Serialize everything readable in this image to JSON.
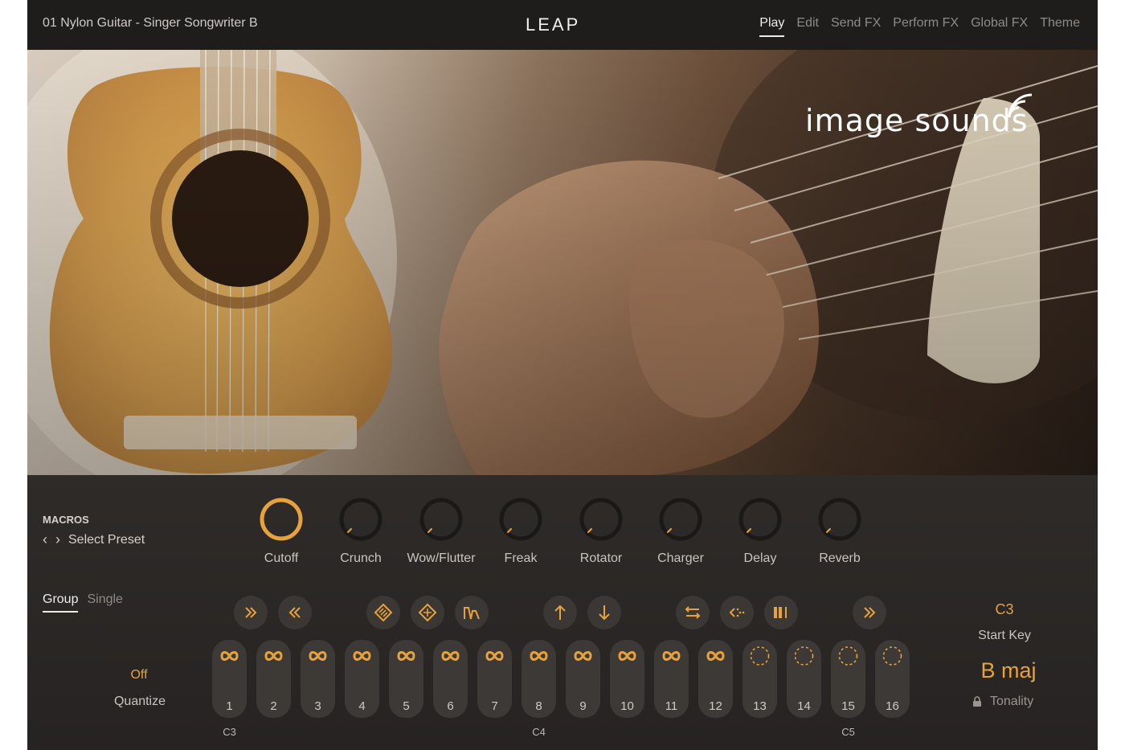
{
  "header": {
    "preset_name": "01 Nylon Guitar - Singer Songwriter B",
    "logo": "LEAP",
    "tabs": [
      {
        "label": "Play",
        "active": true
      },
      {
        "label": "Edit",
        "active": false
      },
      {
        "label": "Send FX",
        "active": false
      },
      {
        "label": "Perform FX",
        "active": false
      },
      {
        "label": "Global FX",
        "active": false
      },
      {
        "label": "Theme",
        "active": false
      }
    ]
  },
  "hero": {
    "brand_logo": "image sounds"
  },
  "macros": {
    "title": "MACROS",
    "select_preset_label": "Select Preset",
    "knobs": [
      {
        "label": "Cutoff",
        "active": true
      },
      {
        "label": "Crunch",
        "active": false
      },
      {
        "label": "Wow/Flutter",
        "active": false
      },
      {
        "label": "Freak",
        "active": false
      },
      {
        "label": "Rotator",
        "active": false
      },
      {
        "label": "Charger",
        "active": false
      },
      {
        "label": "Delay",
        "active": false
      },
      {
        "label": "Reverb",
        "active": false
      }
    ]
  },
  "mode": {
    "tabs": [
      {
        "label": "Group",
        "active": true
      },
      {
        "label": "Single",
        "active": false
      }
    ]
  },
  "quantize": {
    "value": "Off",
    "label": "Quantize"
  },
  "modifier_buttons": [
    {
      "icon": "fast-forward-icon"
    },
    {
      "icon": "rewind-icon"
    },
    {
      "icon": "stutter-a-icon"
    },
    {
      "icon": "stutter-b-icon"
    },
    {
      "icon": "envelope-icon"
    },
    {
      "icon": "pitch-up-icon"
    },
    {
      "icon": "pitch-down-icon"
    },
    {
      "icon": "reverse-icon"
    },
    {
      "icon": "scatter-icon"
    },
    {
      "icon": "slice-icon"
    },
    {
      "icon": "fast-forward-icon"
    }
  ],
  "pads": [
    {
      "number": "1",
      "mode": "loop"
    },
    {
      "number": "2",
      "mode": "loop"
    },
    {
      "number": "3",
      "mode": "loop"
    },
    {
      "number": "4",
      "mode": "loop"
    },
    {
      "number": "5",
      "mode": "loop"
    },
    {
      "number": "6",
      "mode": "loop"
    },
    {
      "number": "7",
      "mode": "loop"
    },
    {
      "number": "8",
      "mode": "loop"
    },
    {
      "number": "9",
      "mode": "loop"
    },
    {
      "number": "10",
      "mode": "loop"
    },
    {
      "number": "11",
      "mode": "loop"
    },
    {
      "number": "12",
      "mode": "loop"
    },
    {
      "number": "13",
      "mode": "one-shot"
    },
    {
      "number": "14",
      "mode": "one-shot"
    },
    {
      "number": "15",
      "mode": "one-shot"
    },
    {
      "number": "16",
      "mode": "one-shot"
    }
  ],
  "note_labels": [
    "C3",
    "C4",
    "C5"
  ],
  "keys": {
    "start_key_value": "C3",
    "start_key_label": "Start Key",
    "tonality_value": "B  maj",
    "tonality_label": "Tonality"
  },
  "colors": {
    "accent": "#e8a23c",
    "panel": "#2a2726",
    "header": "#1f1d1c"
  }
}
